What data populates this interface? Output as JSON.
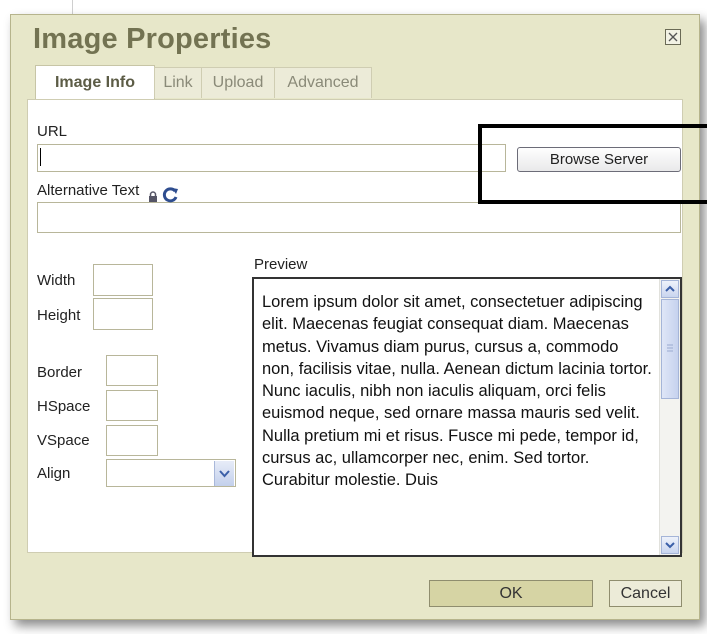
{
  "dialog": {
    "title": "Image Properties",
    "close_icon": "close-icon"
  },
  "tabs": [
    {
      "label": "Image Info",
      "active": true
    },
    {
      "label": "Link",
      "active": false
    },
    {
      "label": "Upload",
      "active": false
    },
    {
      "label": "Advanced",
      "active": false
    }
  ],
  "form": {
    "url_label": "URL",
    "url_value": "",
    "browse_label": "Browse Server",
    "alt_label": "Alternative Text",
    "alt_value": "",
    "width_label": "Width",
    "height_label": "Height",
    "border_label": "Border",
    "hspace_label": "HSpace",
    "vspace_label": "VSpace",
    "align_label": "Align",
    "align_value": ""
  },
  "preview": {
    "label": "Preview",
    "text": "Lorem ipsum dolor sit amet, consectetuer adipiscing elit. Maecenas feugiat consequat diam. Maecenas metus. Vivamus diam purus, cursus a, commodo non, facilisis vitae, nulla. Aenean dictum lacinia tortor. Nunc iaculis, nibh non iaculis aliquam, orci felis euismod neque, sed ornare massa mauris sed velit. Nulla pretium mi et risus. Fusce mi pede, tempor id, cursus ac, ullamcorper nec, enim. Sed tortor. Curabitur molestie. Duis"
  },
  "footer": {
    "ok_label": "OK",
    "cancel_label": "Cancel"
  },
  "colors": {
    "dialog_bg": "#e7e7c9",
    "title": "#737352",
    "highlight": "#000000"
  }
}
